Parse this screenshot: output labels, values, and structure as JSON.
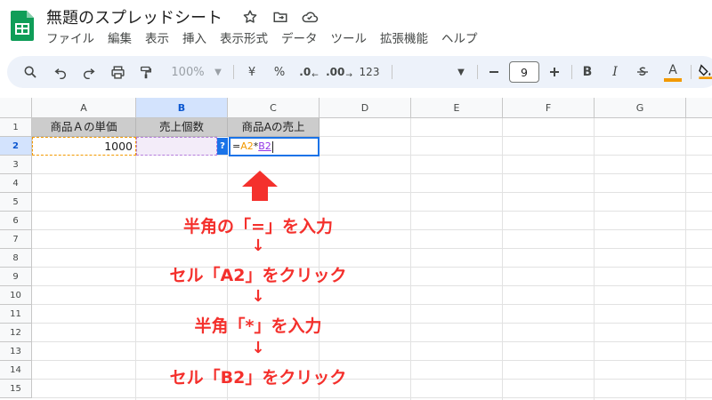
{
  "header": {
    "doc_title": "無題のスプレッドシート",
    "menus": [
      "ファイル",
      "編集",
      "表示",
      "挿入",
      "表示形式",
      "データ",
      "ツール",
      "拡張機能",
      "ヘルプ"
    ]
  },
  "toolbar": {
    "zoom": "100%",
    "currency": "¥",
    "percent": "%",
    "dec_decrease": ".0",
    "dec_increase": ".00",
    "number_format": "123",
    "font_size": "9",
    "bold": "B",
    "italic": "I",
    "text_color": "A",
    "text_color_accent": "#f29900"
  },
  "grid": {
    "columns": [
      "A",
      "B",
      "C",
      "D",
      "E",
      "F",
      "G"
    ],
    "active_column": "B",
    "rows": [
      "1",
      "2",
      "3",
      "4",
      "5",
      "6",
      "7",
      "8",
      "9",
      "10",
      "11",
      "12",
      "13",
      "14",
      "15"
    ],
    "active_row": "2",
    "cells": {
      "A1": "商品Ａの単価",
      "B1": "売上個数",
      "C1": "商品Aの売上",
      "A2": "1000",
      "C2_eq": "=",
      "C2_ref1": "A2",
      "C2_op": "*",
      "C2_ref2": "B2",
      "hint_badge": "?"
    }
  },
  "annotation": {
    "steps": [
      "半角の「=」を入力",
      "セル「A2」をクリック",
      "半角「*」を入力",
      "セル「B2」をクリック"
    ],
    "arrow": "↓",
    "color": "#f4302c"
  }
}
